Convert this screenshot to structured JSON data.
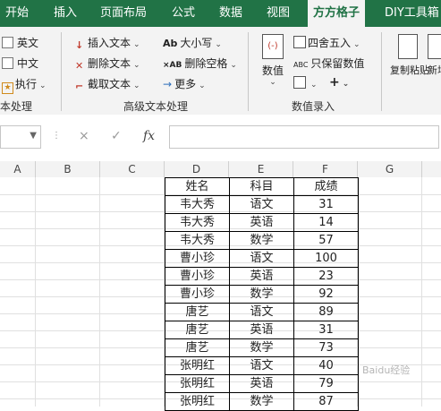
{
  "tabs": [
    "开始",
    "插入",
    "页面布局",
    "公式",
    "数据",
    "视图",
    "方方格子",
    "DIY工具箱"
  ],
  "ribbon": {
    "left": {
      "items": [
        "英文",
        "中文",
        "执行"
      ],
      "group_label": "本处理"
    },
    "advanced_text": {
      "col1": [
        "插入文本",
        "删除文本",
        "截取文本"
      ],
      "col2": [
        "大小写",
        "删除空格",
        "更多"
      ],
      "group_label": "高级文本处理"
    },
    "numeric": {
      "big_button": "数值",
      "items": [
        "四舍五入",
        "只保留数值"
      ],
      "group_label": "数值录入"
    },
    "paste": {
      "copy_paste": "复制粘贴",
      "new": "新增"
    }
  },
  "formula_bar": {
    "fx": "fx",
    "cancel": "×",
    "confirm": "✓"
  },
  "columns": [
    "A",
    "B",
    "C",
    "D",
    "E",
    "F",
    "G"
  ],
  "table": {
    "headers": [
      "姓名",
      "科目",
      "成绩"
    ],
    "rows": [
      [
        "韦大秀",
        "语文",
        "31"
      ],
      [
        "韦大秀",
        "英语",
        "14"
      ],
      [
        "韦大秀",
        "数学",
        "57"
      ],
      [
        "曹小珍",
        "语文",
        "100"
      ],
      [
        "曹小珍",
        "英语",
        "23"
      ],
      [
        "曹小珍",
        "数学",
        "92"
      ],
      [
        "唐艺",
        "语文",
        "89"
      ],
      [
        "唐艺",
        "英语",
        "31"
      ],
      [
        "唐艺",
        "数学",
        "73"
      ],
      [
        "张明红",
        "语文",
        "40"
      ],
      [
        "张明红",
        "英语",
        "79"
      ],
      [
        "张明红",
        "数学",
        "87"
      ]
    ]
  },
  "watermark": "Baidu经验"
}
